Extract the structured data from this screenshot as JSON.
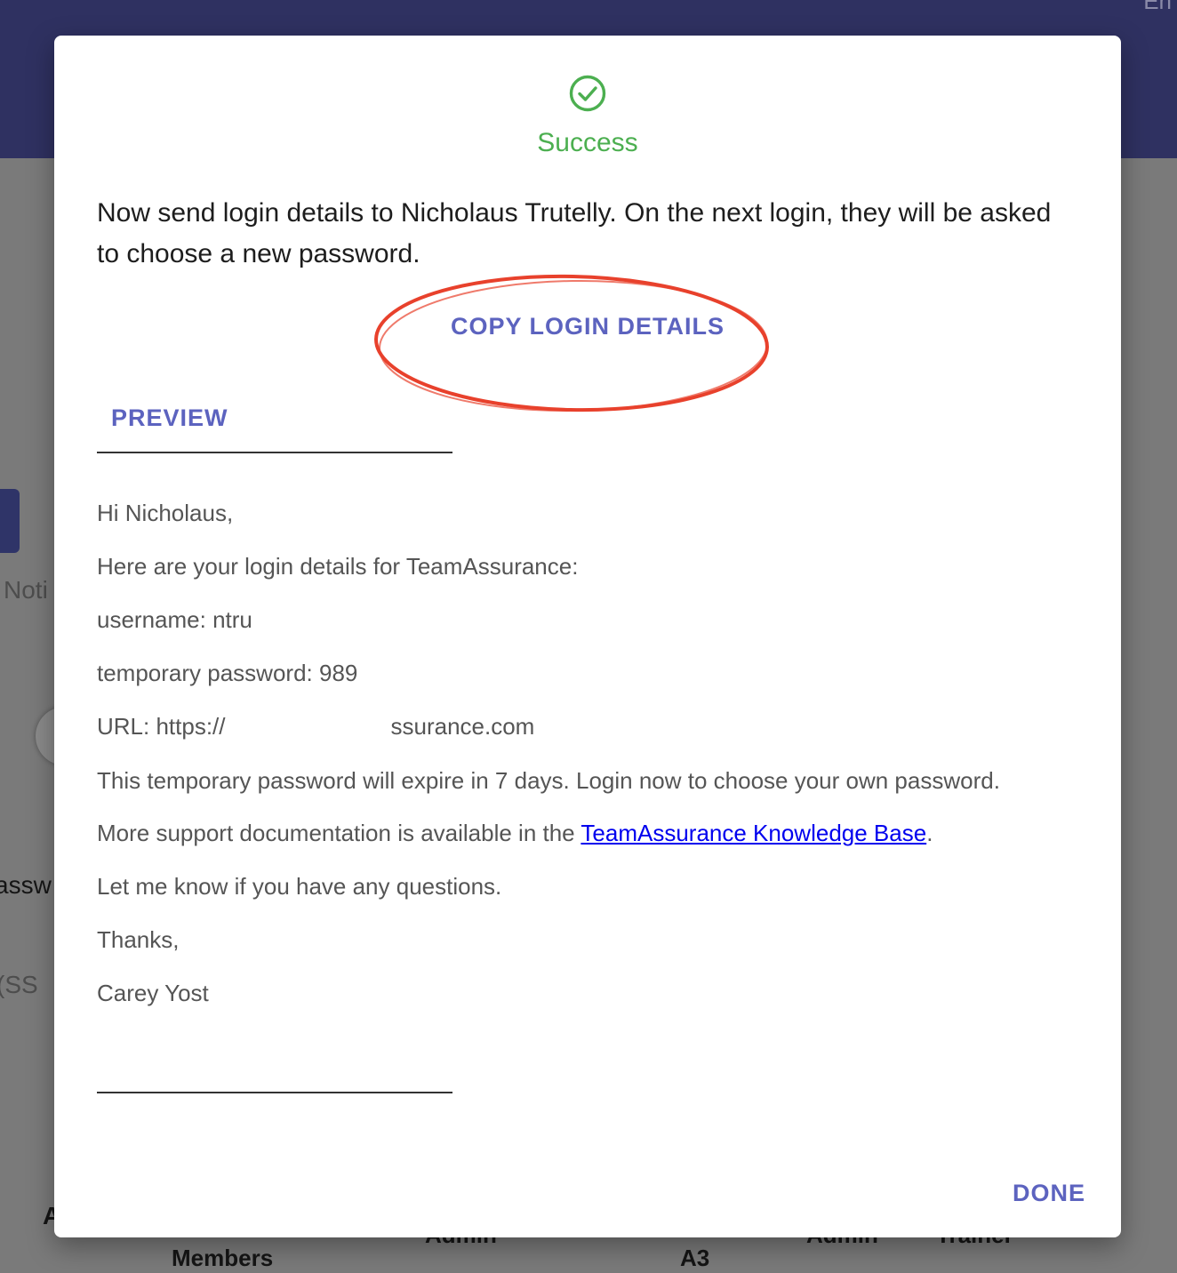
{
  "background": {
    "corner_text": "En",
    "fragments": {
      "noti": "Noti",
      "assw": "assw",
      "ss": "(SS",
      "a": "A",
      "members": "Members",
      "admin1": "Admin",
      "a3": "A3",
      "admin2": "Admin",
      "trainer": "Trainer"
    }
  },
  "dialog": {
    "success_title": "Success",
    "intro": "Now send login details to Nicholaus Trutelly. On the next login, they will be asked to choose a new password.",
    "copy_button": "COPY LOGIN DETAILS",
    "tab_preview": "PREVIEW",
    "email": {
      "greeting": "Hi Nicholaus,",
      "line_details": "Here are your login details for TeamAssurance:",
      "username": "username: ntru",
      "temp_password": "temporary password: 989",
      "url_prefix": "URL: https://",
      "url_suffix": "ssurance.com",
      "expiry": "This temporary password will expire in 7 days. Login now to choose your own password.",
      "support_prefix": "More support documentation is available in the ",
      "support_link": "TeamAssurance Knowledge Base",
      "support_suffix": ".",
      "questions": "Let me know if you have any questions.",
      "thanks": "Thanks,",
      "signature": "Carey Yost"
    },
    "done_button": "DONE"
  },
  "colors": {
    "accent": "#5c63bf",
    "success": "#4caf50",
    "annotation": "#e8412c",
    "header": "#2f3161"
  },
  "icons": {
    "success": "check-circle-icon"
  }
}
